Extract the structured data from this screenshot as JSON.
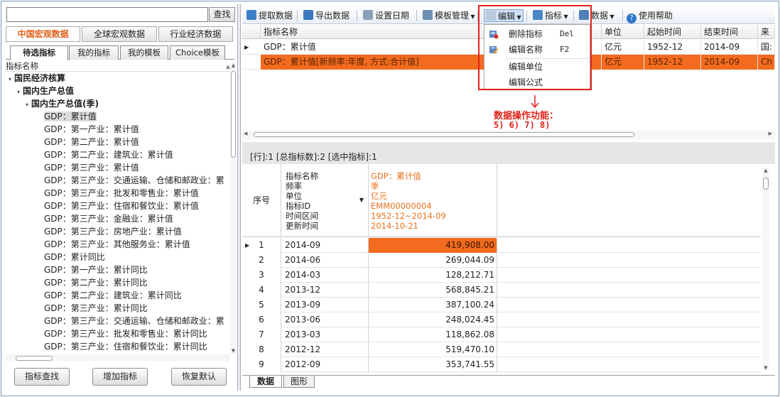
{
  "search": {
    "value": "",
    "button_label": "查找"
  },
  "category_tabs": [
    {
      "label": "中国宏观数据",
      "active": true
    },
    {
      "label": "全球宏观数据",
      "active": false
    },
    {
      "label": "行业经济数据",
      "active": false
    }
  ],
  "sub_tabs": [
    {
      "label": "待选指标",
      "active": true
    },
    {
      "label": "我的指标",
      "active": false
    },
    {
      "label": "我的模板",
      "active": false
    },
    {
      "label": "Choice模板",
      "active": false
    }
  ],
  "tree": {
    "header": "指标名称",
    "nodes": [
      {
        "label": "国民经济核算",
        "level": 0,
        "expanded": true
      },
      {
        "label": "国内生产总值",
        "level": 1,
        "expanded": true
      },
      {
        "label": "国内生产总值(季)",
        "level": 2,
        "expanded": true
      },
      {
        "label": "GDP：累计值",
        "level": 3,
        "selected": true
      },
      {
        "label": "GDP：第一产业：累计值",
        "level": 3
      },
      {
        "label": "GDP：第二产业：累计值",
        "level": 3
      },
      {
        "label": "GDP：第二产业：建筑业：累计值",
        "level": 3
      },
      {
        "label": "GDP：第三产业：累计值",
        "level": 3
      },
      {
        "label": "GDP：第三产业：交通运输、仓储和邮政业：累",
        "level": 3
      },
      {
        "label": "GDP：第三产业：批发和零售业：累计值",
        "level": 3
      },
      {
        "label": "GDP：第三产业：住宿和餐饮业：累计值",
        "level": 3
      },
      {
        "label": "GDP：第三产业：金融业：累计值",
        "level": 3
      },
      {
        "label": "GDP：第三产业：房地产业：累计值",
        "level": 3
      },
      {
        "label": "GDP：第三产业：其他服务业：累计值",
        "level": 3
      },
      {
        "label": "GDP：累计同比",
        "level": 3
      },
      {
        "label": "GDP：第一产业：累计同比",
        "level": 3
      },
      {
        "label": "GDP：第二产业：累计同比",
        "level": 3
      },
      {
        "label": "GDP：第二产业：建筑业：累计同比",
        "level": 3
      },
      {
        "label": "GDP：第三产业：累计同比",
        "level": 3
      },
      {
        "label": "GDP：第三产业：交通运输、仓储和邮政业：累",
        "level": 3
      },
      {
        "label": "GDP：第三产业：批发和零售业：累计同比",
        "level": 3
      },
      {
        "label": "GDP：第三产业：住宿和餐饮业：累计同比",
        "level": 3
      }
    ]
  },
  "left_buttons": [
    "指标查找",
    "增加指标",
    "恢复默认"
  ],
  "toolbar": {
    "extract": "提取数据",
    "export": "导出数据",
    "set_date": "设置日期",
    "template": "模板管理",
    "edit": "编辑",
    "indicator": "指标",
    "data": "数据",
    "help": "使用帮助"
  },
  "grid1": {
    "columns": [
      "指标名称",
      "单位",
      "起始时间",
      "结束时间",
      "来"
    ],
    "rows": [
      {
        "name": "GDP：累计值",
        "unit": "亿元",
        "start": "1952-12",
        "end": "2014-09",
        "src": "国:",
        "highlight": false
      },
      {
        "name": "GDP：累计值[新频率:年度, 方式:合计值]",
        "unit": "亿元",
        "start": "1952-12",
        "end": "2014-09",
        "src": "Ch",
        "highlight": true
      }
    ]
  },
  "edit_menu": [
    {
      "label": "删除指标",
      "shortcut": "Del",
      "icon": "delete-indicator-icon"
    },
    {
      "label": "编辑名称",
      "shortcut": "F2",
      "icon": "edit-name-icon"
    },
    {
      "label": "编辑单位",
      "shortcut": ""
    },
    {
      "label": "编辑公式",
      "shortcut": ""
    }
  ],
  "annotation": {
    "title": "数据操作功能：",
    "items": "5)  6)  7)  8)"
  },
  "status": "[行]:1 [总指标数]:2 [选中指标]:1",
  "grid2": {
    "seq_header": "序号",
    "attr_labels": [
      "指标名称",
      "频率",
      "单位",
      "指标ID",
      "时间区间",
      "更新时间"
    ],
    "attr_values": [
      "GDP：累计值",
      "季",
      "亿元",
      "EMM00000004",
      "1952-12~2014-09",
      "2014-10-21"
    ],
    "rows": [
      {
        "seq": "1",
        "date": "2014-09",
        "value": "419,908.00",
        "highlight": true
      },
      {
        "seq": "2",
        "date": "2014-06",
        "value": "269,044.09"
      },
      {
        "seq": "3",
        "date": "2014-03",
        "value": "128,212.71"
      },
      {
        "seq": "4",
        "date": "2013-12",
        "value": "568,845.21"
      },
      {
        "seq": "5",
        "date": "2013-09",
        "value": "387,100.24"
      },
      {
        "seq": "6",
        "date": "2013-06",
        "value": "248,024.45"
      },
      {
        "seq": "7",
        "date": "2013-03",
        "value": "118,862.08"
      },
      {
        "seq": "8",
        "date": "2012-12",
        "value": "519,470.10"
      },
      {
        "seq": "9",
        "date": "2012-09",
        "value": "353,741.55"
      }
    ]
  },
  "bottom_tabs": [
    {
      "label": "数据",
      "active": true
    },
    {
      "label": "图形",
      "active": false
    }
  ],
  "colors": {
    "accent_orange": "#f26b1f",
    "annotation_red": "#e0231a",
    "category_active": "#e0621a"
  }
}
